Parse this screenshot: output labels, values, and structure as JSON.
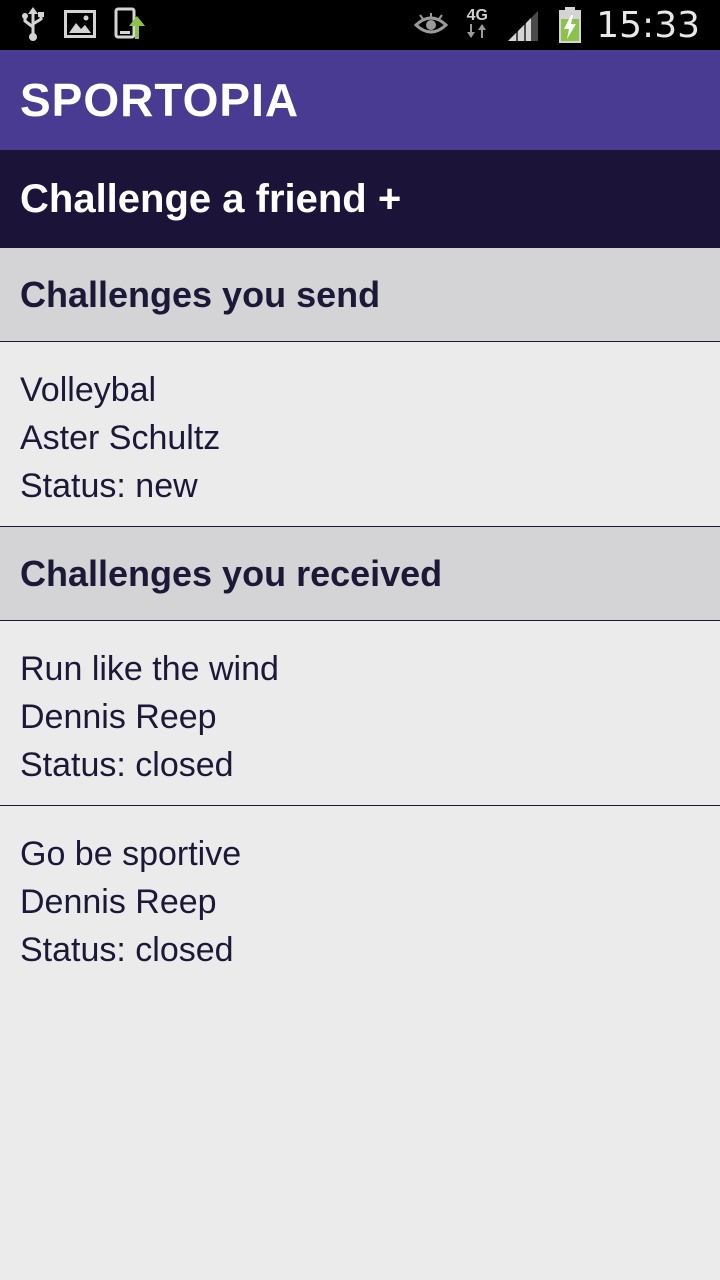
{
  "status_bar": {
    "left_icons": [
      "usb-icon",
      "image-icon",
      "phone-upload-icon"
    ],
    "right_icons": [
      "eye-icon",
      "signal-icon",
      "battery-charging-icon"
    ],
    "network_label": "4G",
    "time": "15:33"
  },
  "app_bar": {
    "title": "SPORTOPIA"
  },
  "challenge_button": {
    "label": "Challenge a friend +"
  },
  "sections": [
    {
      "title": "Challenges you send",
      "items": [
        {
          "name": "Volleybal",
          "person": "Aster Schultz",
          "status": "Status: new"
        }
      ]
    },
    {
      "title": "Challenges you received",
      "items": [
        {
          "name": "Run like the wind",
          "person": "Dennis Reep",
          "status": "Status: closed"
        },
        {
          "name": "Go be sportive",
          "person": "Dennis Reep",
          "status": "Status: closed"
        }
      ]
    }
  ],
  "colors": {
    "app_bar": "#4a3b92",
    "challenge_bar": "#1b1438",
    "section_header": "#d4d3d5",
    "background": "#ebebeb",
    "text": "#1c1838",
    "battery_fill": "#8bc34a"
  }
}
